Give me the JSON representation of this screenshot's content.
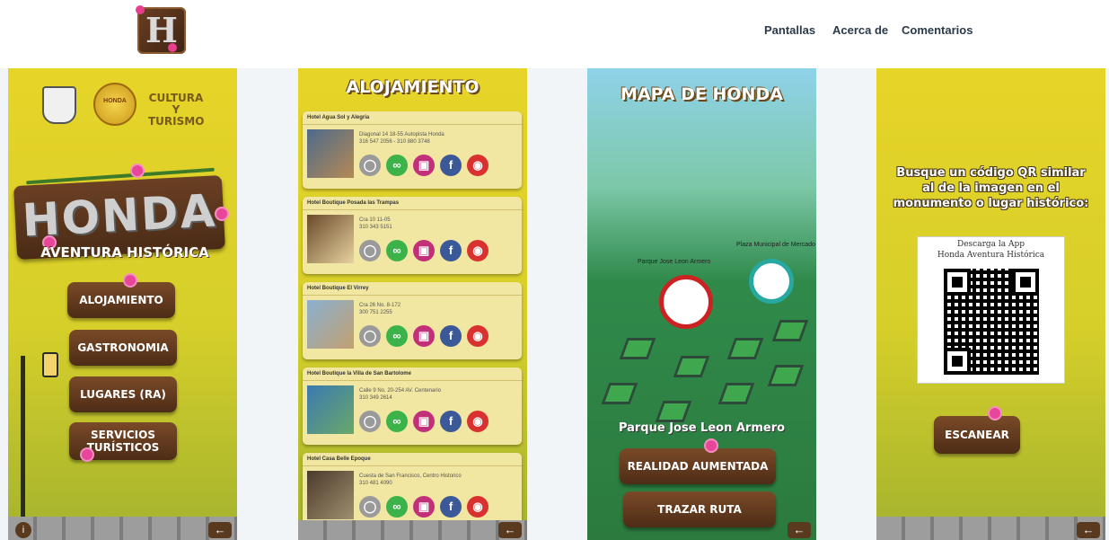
{
  "nav": {
    "pantallas": "Pantallas",
    "acerca": "Acerca de",
    "comentarios": "Comentarios"
  },
  "logo": {
    "letter": "H"
  },
  "screen1": {
    "culture_logo": "CULTURA Y TURISMO",
    "seal_text": "HONDA",
    "app_title": "HONDA",
    "app_subtitle": "AVENTURA HISTÓRICA",
    "buttons": [
      "ALOJAMIENTO",
      "GASTRONOMIA",
      "LUGARES (RA)",
      "SERVICIOS TURÍSTICOS"
    ]
  },
  "screen2": {
    "title": "ALOJAMIENTO",
    "hotels": [
      {
        "name": "Hotel Agua Sol y Alegria",
        "address": "Diagonal 14 18-55 Autopista Honda",
        "phone": "316 547 2056 - 310 880 3748"
      },
      {
        "name": "Hotel Boutique Posada las Trampas",
        "address": "Cra 10 11-05",
        "phone": "310 343 5151"
      },
      {
        "name": "Hotel Boutique El Virrey",
        "address": "Cra 26 No. 8-172",
        "phone": "300 751 2255"
      },
      {
        "name": "Hotel Boutique la Villa de San Bartolome",
        "address": "Calle 9 No. 20-254 AV. Centenario",
        "phone": "310 349 2614"
      },
      {
        "name": "Hotel Casa Belle Epoque",
        "address": "Cuesta de San Francisco, Centro Historico",
        "phone": "310 481 4090"
      }
    ],
    "icons": [
      "globe-icon",
      "tripadvisor-icon",
      "instagram-icon",
      "facebook-icon",
      "location-icon"
    ]
  },
  "screen3": {
    "title": "MAPA DE HONDA",
    "pin1_label": "Parque Jose Leon Armero",
    "pin2_label": "Plaza Municipal de Mercado",
    "selected_place": "Parque Jose Leon Armero",
    "btn_ar": "REALIDAD AUMENTADA",
    "btn_route": "TRAZAR RUTA"
  },
  "screen4": {
    "instructions": "Busque un código QR similar al de la imagen en el monumento o lugar histórico:",
    "qr_line1": "Descarga la App",
    "qr_line2": "Honda Aventura Histórica",
    "scan_button": "ESCANEAR"
  },
  "colors": {
    "nav_text": "#2a3a4a",
    "yellow_bg": "#e7d428",
    "wood": "#5a3a1f",
    "pink_flower": "#e8469a"
  }
}
